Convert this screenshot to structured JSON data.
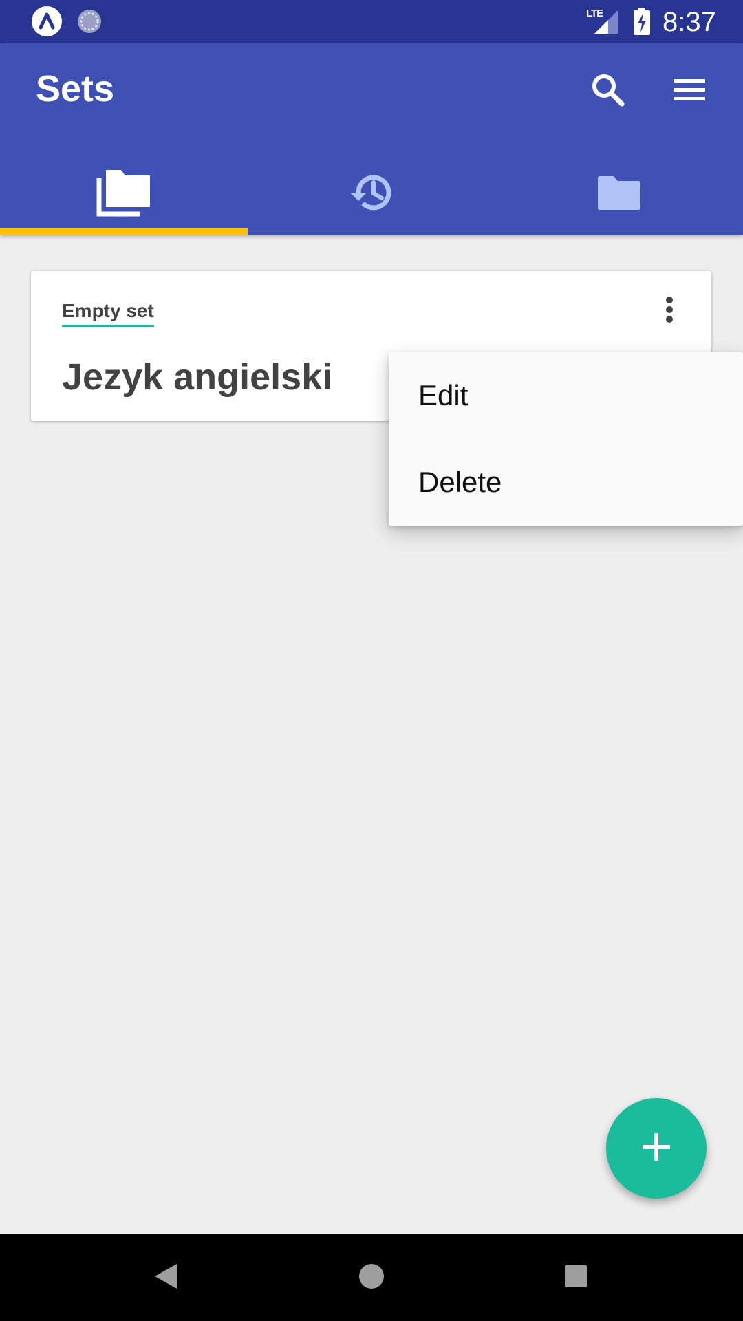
{
  "status_bar": {
    "time": "8:37",
    "network": "LTE",
    "icons": [
      "app-icon",
      "sync-icon",
      "lte-signal-icon",
      "battery-charging-icon"
    ]
  },
  "app_bar": {
    "title": "Sets",
    "actions": [
      "search-icon",
      "hamburger-menu-icon"
    ]
  },
  "tabs": [
    {
      "icon": "library-icon",
      "selected": true
    },
    {
      "icon": "history-icon",
      "selected": false
    },
    {
      "icon": "folder-icon",
      "selected": false
    }
  ],
  "card": {
    "status": "Empty set",
    "title": "Jezyk angielski",
    "more_icon": "more-vert-icon"
  },
  "context_menu": {
    "items": [
      {
        "label": "Edit"
      },
      {
        "label": "Delete"
      }
    ]
  },
  "fab": {
    "icon": "add-icon"
  },
  "nav_bar": {
    "buttons": [
      "back-icon",
      "home-icon",
      "recents-icon"
    ]
  },
  "colors": {
    "status_bar": "#283593",
    "app_bar": "#3f51b5",
    "tab_indicator": "#ffc107",
    "accent": "#1abc9c",
    "inactive_tab_icon": "#b0c4f7",
    "background": "#eeeeee"
  }
}
